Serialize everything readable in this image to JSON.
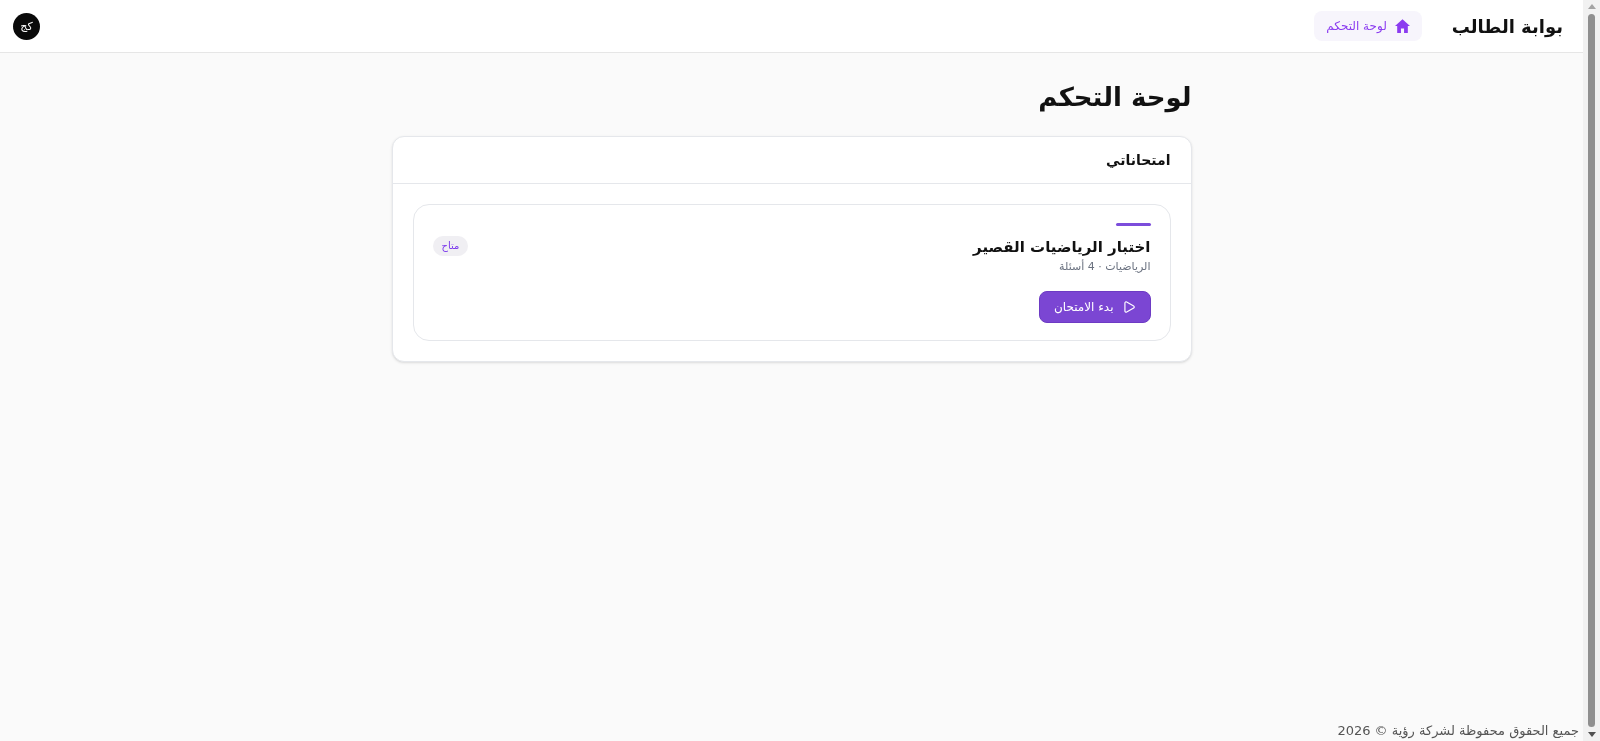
{
  "header": {
    "title": "بوابة الطالب",
    "nav": [
      {
        "label": "لوحة التحكم",
        "selected": true
      }
    ],
    "avatar": {
      "initials": "كج"
    }
  },
  "page": {
    "title": "لوحة التحكم"
  },
  "exams_card": {
    "title": "امتحاناتي",
    "exams": [
      {
        "title": "اختبار الرياضيات القصير",
        "meta": "الرياضيات · 4 أسئلة",
        "status": "متاح",
        "button": "بدء الامتحان"
      }
    ]
  },
  "footer": {
    "text": "جميع الحقوق محفوظة لشركة رؤية © 2026"
  }
}
